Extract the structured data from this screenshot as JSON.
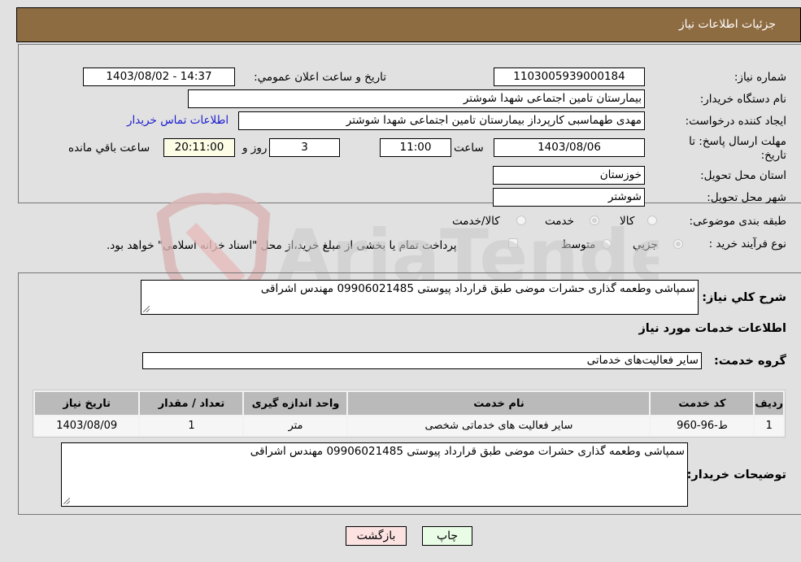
{
  "header": {
    "title": "جزئیات اطلاعات نیاز"
  },
  "details": {
    "need_number": {
      "label": "شماره نیاز:",
      "value": "1103005939000184"
    },
    "announce_datetime": {
      "label": "تاریخ و ساعت اعلان عمومي:",
      "value": "1403/08/02 - 14:37"
    },
    "buyer_org": {
      "label": "نام دستگاه خریدار:",
      "value": "بیمارستان تامین اجتماعی شهدا شوشتر"
    },
    "requester": {
      "label": "ایجاد کننده درخواست:",
      "value": "مهدی طهماسبی کارپرداز بیمارستان تامین اجتماعی شهدا شوشتر"
    },
    "buyer_contact_link": "اطلاعات تماس خریدار",
    "deadline": {
      "label": "مهلت ارسال پاسخ: تا تاریخ:",
      "date": "1403/08/06",
      "time_label": "ساعت",
      "time": "11:00",
      "days": "3",
      "days_label": "روز و",
      "remaining": "20:11:00",
      "remaining_label": "ساعت باقي مانده"
    },
    "delivery_province": {
      "label": "استان محل تحویل:",
      "value": "خوزستان"
    },
    "delivery_city": {
      "label": "شهر محل تحویل:",
      "value": "شوشتر"
    },
    "category": {
      "label": "طبقه بندی موضوعی:",
      "options": [
        {
          "label": "کالا",
          "selected": false
        },
        {
          "label": "خدمت",
          "selected": true
        },
        {
          "label": "کالا/خدمت",
          "selected": false
        }
      ]
    },
    "purchase_process": {
      "label": "نوع فرآیند خرید :",
      "options": [
        {
          "label": "جزیي",
          "selected": true
        },
        {
          "label": "متوسط",
          "selected": false
        }
      ],
      "treasury_checkbox_label": "پرداخت تمام یا بخشی از مبلغ خرید،از محل \"اسناد خزانه اسلامی\" خواهد بود.",
      "treasury_checked": false
    }
  },
  "summary": {
    "label": "شرح کلي نیاز:",
    "value": "سمپاشی وطعمه گذاری حشرات موضی طبق قرارداد پیوستی 09906021485 مهندس اشراقی"
  },
  "services": {
    "section_title": "اطلاعات خدمات مورد نیاز",
    "group_label": "گروه خدمت:",
    "group_value": "سایر فعالیت‌های خدماتی",
    "table": {
      "headers": [
        "ردیف",
        "کد خدمت",
        "نام خدمت",
        "واحد اندازه گیری",
        "تعداد / مقدار",
        "تاریخ نیاز"
      ],
      "rows": [
        [
          "1",
          "ط-96-960",
          "سایر فعالیت های خدماتی شخصی",
          "متر",
          "1",
          "1403/08/09"
        ]
      ]
    }
  },
  "buyer_notes": {
    "label": "توضیحات خریدار:",
    "value": "سمپاشی وطعمه گذاری حشرات موضی طبق قرارداد پیوستی 09906021485 مهندس اشراقی"
  },
  "buttons": {
    "print": "چاپ",
    "back": "بازگشت"
  },
  "watermark": {
    "text": "AriaTender.neT"
  }
}
